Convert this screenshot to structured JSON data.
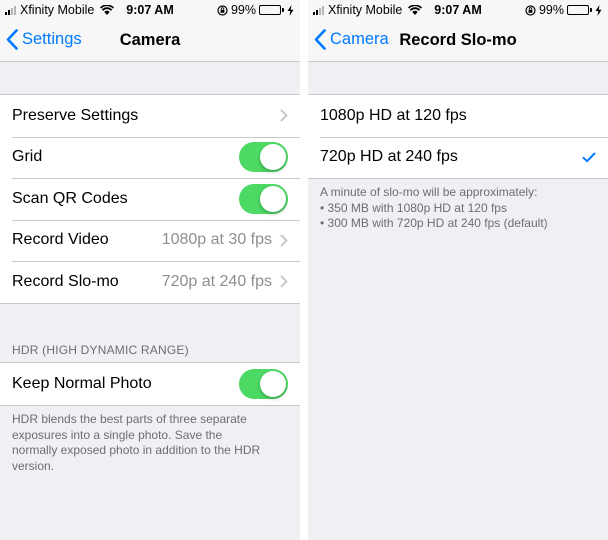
{
  "status_bar": {
    "carrier": "Xfinity Mobile",
    "time": "9:07 AM",
    "battery": "99%",
    "battery_level": 0.99
  },
  "left": {
    "nav": {
      "back_label": "Settings",
      "title": "Camera"
    },
    "rows": [
      {
        "label": "Preserve Settings",
        "value": "",
        "accessory": "chevron"
      },
      {
        "label": "Grid",
        "value": "",
        "accessory": "toggle",
        "on": true
      },
      {
        "label": "Scan QR Codes",
        "value": "",
        "accessory": "toggle",
        "on": true
      },
      {
        "label": "Record Video",
        "value": "1080p at 30 fps",
        "accessory": "chevron"
      },
      {
        "label": "Record Slo-mo",
        "value": "720p at 240 fps",
        "accessory": "chevron"
      }
    ],
    "hdr_section": {
      "header": "HDR (HIGH DYNAMIC RANGE)",
      "row": {
        "label": "Keep Normal Photo",
        "accessory": "toggle",
        "on": true
      },
      "footer_lines": [
        "HDR blends the best parts of three separate",
        "exposures into a single photo. Save the",
        "normally exposed photo in addition to the HDR",
        "version."
      ]
    }
  },
  "right": {
    "nav": {
      "back_label": "Camera",
      "title": "Record Slo-mo"
    },
    "options": [
      {
        "label": "1080p HD at 120 fps",
        "selected": false
      },
      {
        "label": "720p HD at 240 fps",
        "selected": true
      }
    ],
    "footer_lines": [
      "A minute of slo-mo will be approximately:",
      "• 350 MB with 1080p HD at 120 fps",
      "• 300 MB with 720p HD at 240 fps (default)"
    ]
  },
  "colors": {
    "accent": "#007aff",
    "toggle_on": "#4cd964",
    "background": "#efeff4",
    "secondary_text": "#8e8e93",
    "footer_text": "#6d6d72"
  },
  "icons": {
    "back": "chevron-left-icon",
    "disclosure": "chevron-right-icon",
    "selected": "checkmark-icon",
    "wifi": "wifi-icon",
    "orientation_lock": "orientation-lock-icon",
    "charging": "lightning-bolt-icon"
  }
}
